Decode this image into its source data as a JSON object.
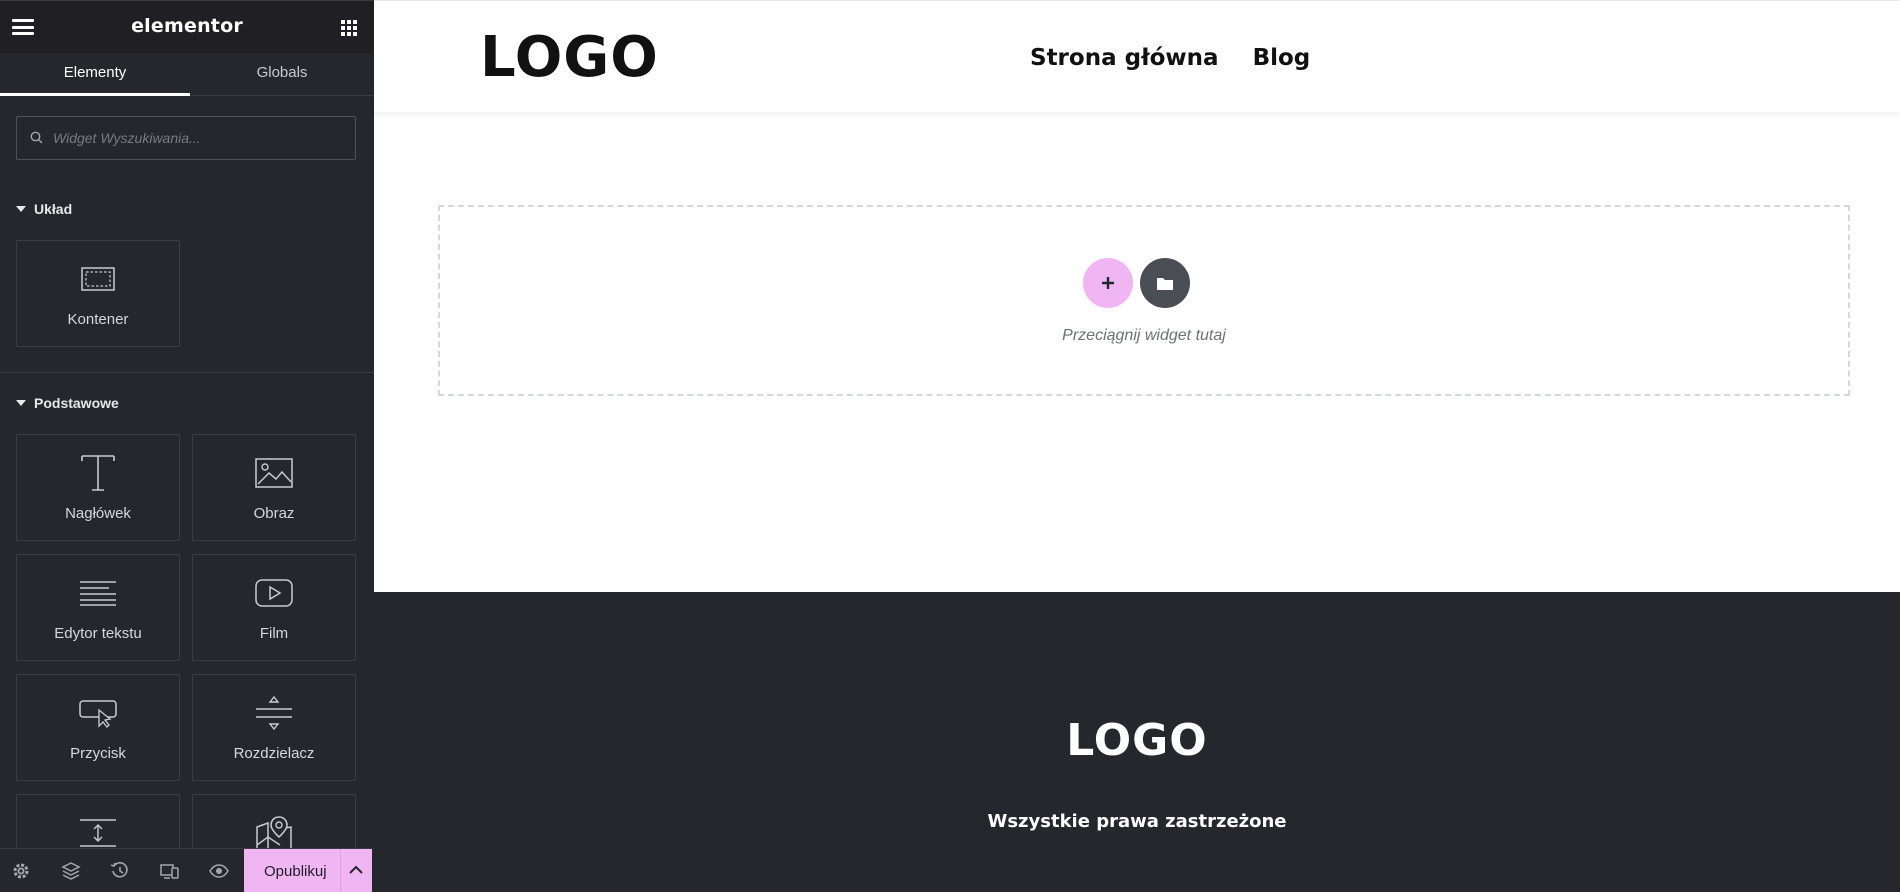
{
  "sidebar": {
    "brand": "elementor",
    "tabs": [
      {
        "label": "Elementy",
        "active": true
      },
      {
        "label": "Globals",
        "active": false
      }
    ],
    "search": {
      "placeholder": "Widget Wyszukiwania...",
      "value": ""
    },
    "sections": [
      {
        "title": "Układ",
        "widgets": [
          {
            "label": "Kontener",
            "icon": "container-icon"
          }
        ]
      },
      {
        "title": "Podstawowe",
        "widgets": [
          {
            "label": "Nagłówek",
            "icon": "heading-icon"
          },
          {
            "label": "Obraz",
            "icon": "image-icon"
          },
          {
            "label": "Edytor tekstu",
            "icon": "text-editor-icon"
          },
          {
            "label": "Film",
            "icon": "video-icon"
          },
          {
            "label": "Przycisk",
            "icon": "button-icon"
          },
          {
            "label": "Rozdzielacz",
            "icon": "divider-icon"
          },
          {
            "label": "",
            "icon": "spacer-icon"
          },
          {
            "label": "",
            "icon": "google-maps-icon"
          }
        ]
      }
    ],
    "bottom_bar": {
      "icons": [
        "settings-icon",
        "navigator-icon",
        "history-icon",
        "responsive-icon",
        "preview-icon"
      ],
      "publish_label": "Opublikuj"
    }
  },
  "canvas": {
    "header": {
      "logo": "LOGO",
      "nav": [
        "Strona główna",
        "Blog"
      ]
    },
    "dropzone": {
      "add_icon": "plus-icon",
      "library_icon": "folder-icon",
      "hint": "Przeciągnij widget tutaj"
    },
    "footer": {
      "logo": "LOGO",
      "copyright": "Wszystkie prawa zastrzeżone"
    }
  },
  "colors": {
    "panel_bg": "#26262d",
    "accent": "#f0b6f4",
    "library_button": "#4b4d55"
  }
}
